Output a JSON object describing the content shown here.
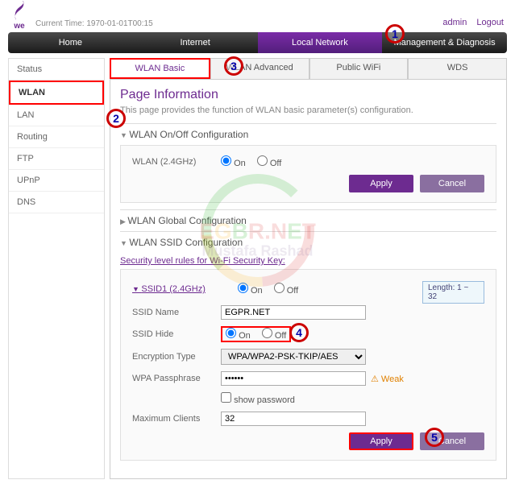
{
  "brand": "we",
  "current_time_label": "Current Time: 1970-01-01T00:15",
  "top_links": {
    "user": "admin",
    "logout": "Logout"
  },
  "nav": {
    "home": "Home",
    "internet": "Internet",
    "local_network": "Local Network",
    "mgmt": "Management & Diagnosis"
  },
  "sidebar": {
    "status": "Status",
    "wlan": "WLAN",
    "lan": "LAN",
    "routing": "Routing",
    "ftp": "FTP",
    "upnp": "UPnP",
    "dns": "DNS"
  },
  "tabs": {
    "basic": "WLAN Basic",
    "advanced": "WLAN Advanced",
    "public": "Public WiFi",
    "wds": "WDS"
  },
  "page_title": "Page Information",
  "page_desc": "This page provides the function of WLAN basic parameter(s) configuration.",
  "sections": {
    "onoff": {
      "title": "WLAN On/Off Configuration",
      "field": "WLAN (2.4GHz)",
      "on": "On",
      "off": "Off",
      "selected": "on"
    },
    "global": {
      "title": "WLAN Global Configuration"
    },
    "ssid": {
      "title": "WLAN SSID Configuration",
      "rules_link": "Security level rules for Wi-Fi Security Key:",
      "ssid_head": "SSID1 (2.4GHz)",
      "ssid_onoff": {
        "on": "On",
        "off": "Off",
        "selected": "on"
      },
      "length_tip": "Length: 1 ~ 32",
      "fields": {
        "name_label": "SSID Name",
        "name_value": "EGPR.NET",
        "hide_label": "SSID Hide",
        "hide_selected": "on",
        "enc_label": "Encryption Type",
        "enc_value": "WPA/WPA2-PSK-TKIP/AES",
        "pass_label": "WPA Passphrase",
        "pass_value": "••••••",
        "show_pw": "show password",
        "max_label": "Maximum Clients",
        "max_value": "32",
        "weak": "Weak"
      }
    }
  },
  "buttons": {
    "apply": "Apply",
    "cancel": "Cancel"
  },
  "annotations": {
    "a1": "1",
    "a2": "2",
    "a3": "3",
    "a4": "4",
    "a5": "5"
  },
  "watermark": {
    "line1": "EGBR.NET",
    "line2": "Mustafa Rashad"
  }
}
